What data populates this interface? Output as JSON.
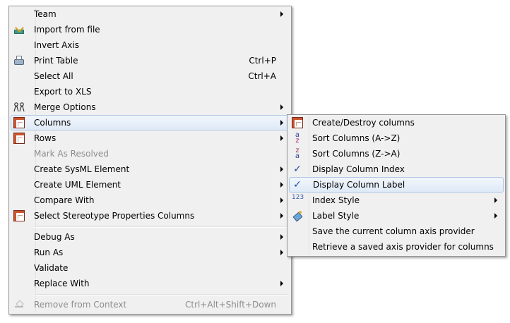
{
  "main_menu": {
    "team": "Team",
    "import_from_file": "Import from file",
    "invert_axis": "Invert Axis",
    "print_table": "Print Table",
    "print_table_shortcut": "Ctrl+P",
    "select_all": "Select All",
    "select_all_shortcut": "Ctrl+A",
    "export_to_xls": "Export to XLS",
    "merge_options": "Merge Options",
    "columns": "Columns",
    "rows": "Rows",
    "mark_as_resolved": "Mark As Resolved",
    "create_sysml_element": "Create SysML Element",
    "create_uml_element": "Create UML Element",
    "compare_with": "Compare With",
    "select_stereotype_properties_columns": "Select Stereotype Properties Columns",
    "debug_as": "Debug As",
    "run_as": "Run As",
    "validate": "Validate",
    "replace_with": "Replace With",
    "remove_from_context": "Remove from Context",
    "remove_from_context_shortcut": "Ctrl+Alt+Shift+Down"
  },
  "columns_submenu": {
    "create_destroy_columns": "Create/Destroy columns",
    "sort_columns_az": "Sort Columns (A->Z)",
    "sort_columns_za": "Sort Columns (Z->A)",
    "display_column_index": "Display Column Index",
    "display_column_label": "Display Column Label",
    "index_style": "Index Style",
    "label_style": "Label Style",
    "save_axis_provider": "Save the current column axis provider",
    "retrieve_axis_provider": "Retrieve a saved axis provider for columns"
  },
  "icons": {
    "checkmark": "✓",
    "sort_az_top": "a",
    "sort_az_bottom": "z",
    "sort_za_top": "z",
    "sort_za_bottom": "a",
    "index_digits": "123"
  },
  "colors": {
    "menu_background": "#f0f0f0",
    "highlight_border": "#b0c7e6",
    "disabled_text": "#8d8d8d"
  }
}
